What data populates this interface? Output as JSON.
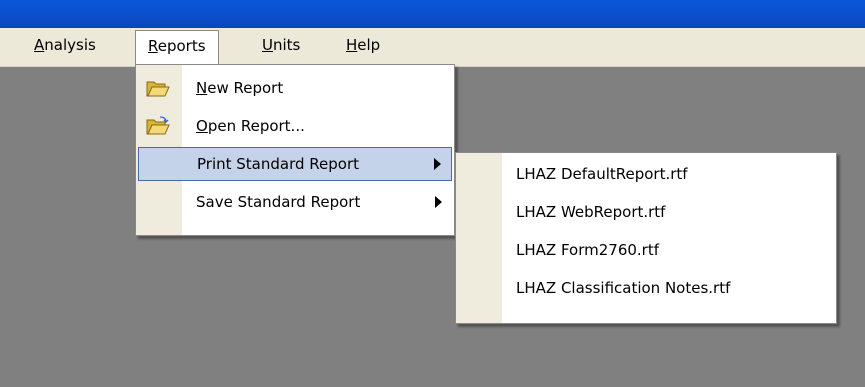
{
  "menubar": {
    "items": [
      {
        "label": "Analysis",
        "mnemonic": "A",
        "rest": "nalysis"
      },
      {
        "label": "Reports",
        "mnemonic": "R",
        "rest": "eports"
      },
      {
        "label": "Units",
        "mnemonic": "U",
        "rest": "nits"
      },
      {
        "label": "Help",
        "mnemonic": "H",
        "rest": "elp"
      }
    ]
  },
  "reports_menu": {
    "items": [
      {
        "mnemonic": "N",
        "rest": "ew Report",
        "icon": "folder-open-icon"
      },
      {
        "mnemonic": "O",
        "rest": "pen Report...",
        "icon": "folder-open-icon"
      },
      {
        "label": "Print Standard Report",
        "has_submenu": true,
        "highlighted": true
      },
      {
        "label": "Save Standard Report",
        "has_submenu": true
      }
    ]
  },
  "print_submenu": {
    "items": [
      {
        "label": "LHAZ DefaultReport.rtf"
      },
      {
        "label": "LHAZ WebReport.rtf"
      },
      {
        "label": "LHAZ Form2760.rtf"
      },
      {
        "label": "LHAZ Classification Notes.rtf"
      }
    ]
  },
  "colors": {
    "workspace": "#808080",
    "menubar": "#ece9d8",
    "highlight": "#c5d3ea",
    "titlebar": "#0a4fc9"
  }
}
